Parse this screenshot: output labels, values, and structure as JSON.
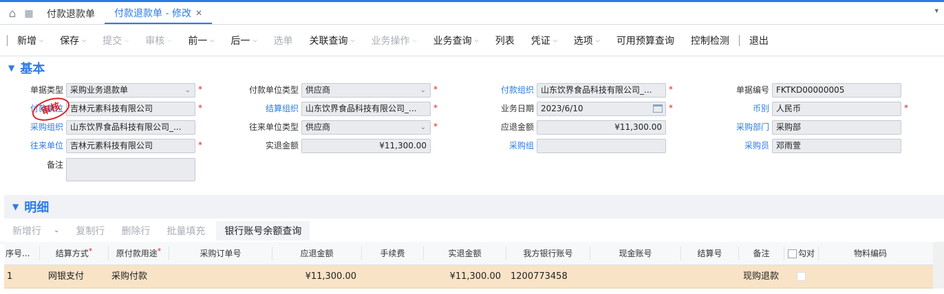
{
  "tabs": {
    "t1": "付款退款单",
    "t2": "付款退款单 - 修改"
  },
  "toolbar": [
    {
      "label": "新增",
      "arrow": true,
      "disabled": false,
      "key": "new"
    },
    {
      "label": "保存",
      "arrow": true,
      "disabled": false,
      "key": "save"
    },
    {
      "label": "提交",
      "arrow": true,
      "disabled": true,
      "key": "submit"
    },
    {
      "label": "审核",
      "arrow": true,
      "disabled": true,
      "key": "audit"
    },
    {
      "label": "前一",
      "arrow": true,
      "disabled": false,
      "key": "prev"
    },
    {
      "label": "后一",
      "arrow": true,
      "disabled": false,
      "key": "next"
    },
    {
      "label": "选单",
      "arrow": false,
      "disabled": true,
      "key": "select-doc"
    },
    {
      "label": "关联查询",
      "arrow": true,
      "disabled": false,
      "key": "related-query"
    },
    {
      "label": "业务操作",
      "arrow": true,
      "disabled": true,
      "key": "business-op"
    },
    {
      "label": "业务查询",
      "arrow": true,
      "disabled": false,
      "key": "business-query"
    },
    {
      "label": "列表",
      "arrow": false,
      "disabled": false,
      "key": "list"
    },
    {
      "label": "凭证",
      "arrow": true,
      "disabled": false,
      "key": "voucher"
    },
    {
      "label": "选项",
      "arrow": true,
      "disabled": false,
      "key": "options"
    },
    {
      "label": "可用预算查询",
      "arrow": false,
      "disabled": false,
      "key": "budget-query"
    },
    {
      "label": "控制检测",
      "arrow": false,
      "disabled": false,
      "key": "control-check"
    },
    {
      "label": "退出",
      "arrow": false,
      "disabled": false,
      "key": "exit",
      "sep_before": true
    }
  ],
  "section_basic": "基本",
  "section_detail": "明细",
  "stamp": "审核",
  "form": {
    "bill_type": {
      "label": "单据类型",
      "value": "采购业务退款单"
    },
    "payee": {
      "label": "付款单位",
      "value": "吉林元素科技有限公司"
    },
    "purchase_org": {
      "label": "采购组织",
      "value": "山东饮界食品科技有限公司_..."
    },
    "contact_unit": {
      "label": "往来单位",
      "value": "吉林元素科技有限公司"
    },
    "remark": {
      "label": "备注",
      "value": ""
    },
    "pay_unit_type": {
      "label": "付款单位类型",
      "value": "供应商"
    },
    "settle_org": {
      "label": "结算组织",
      "value": "山东饮界食品科技有限公司_..."
    },
    "contact_unit_type": {
      "label": "往来单位类型",
      "value": "供应商"
    },
    "actual_refund": {
      "label": "实退金额",
      "value": "¥11,300.00"
    },
    "pay_org": {
      "label": "付款组织",
      "value": "山东饮界食品科技有限公司_..."
    },
    "biz_date": {
      "label": "业务日期",
      "value": "2023/6/10"
    },
    "due_refund": {
      "label": "应退金额",
      "value": "¥11,300.00"
    },
    "purchase_group": {
      "label": "采购组",
      "value": ""
    },
    "bill_no": {
      "label": "单据编号",
      "value": "FKTKD00000005"
    },
    "currency": {
      "label": "币别",
      "value": "人民币"
    },
    "purchase_dept": {
      "label": "采购部门",
      "value": "采购部"
    },
    "purchaser": {
      "label": "采购员",
      "value": "邓雨萱"
    }
  },
  "subtoolbar": {
    "add_row": "新增行",
    "copy_row": "复制行",
    "delete_row": "删除行",
    "batch_fill": "批量填充",
    "bank_balance": "银行账号余额查询"
  },
  "grid": {
    "headers": {
      "seq": "序号...",
      "settle_method": "结算方式",
      "purpose": "原付款用途",
      "po_no": "采购订单号",
      "due": "应退金额",
      "fee": "手续费",
      "actual": "实退金额",
      "bank_acct": "我方银行账号",
      "cash_acct": "现金账号",
      "settle_no": "结算号",
      "remark": "备注",
      "check": "勾对",
      "material": "物料编码"
    },
    "rows": [
      {
        "seq": "1",
        "settle_method": "网银支付",
        "purpose": "采购付款",
        "po_no": "",
        "due": "¥11,300.00",
        "fee": "",
        "actual": "¥11,300.00",
        "bank_acct": "1200773458",
        "cash_acct": "",
        "settle_no": "",
        "remark": "现购退款",
        "material": ""
      }
    ]
  }
}
